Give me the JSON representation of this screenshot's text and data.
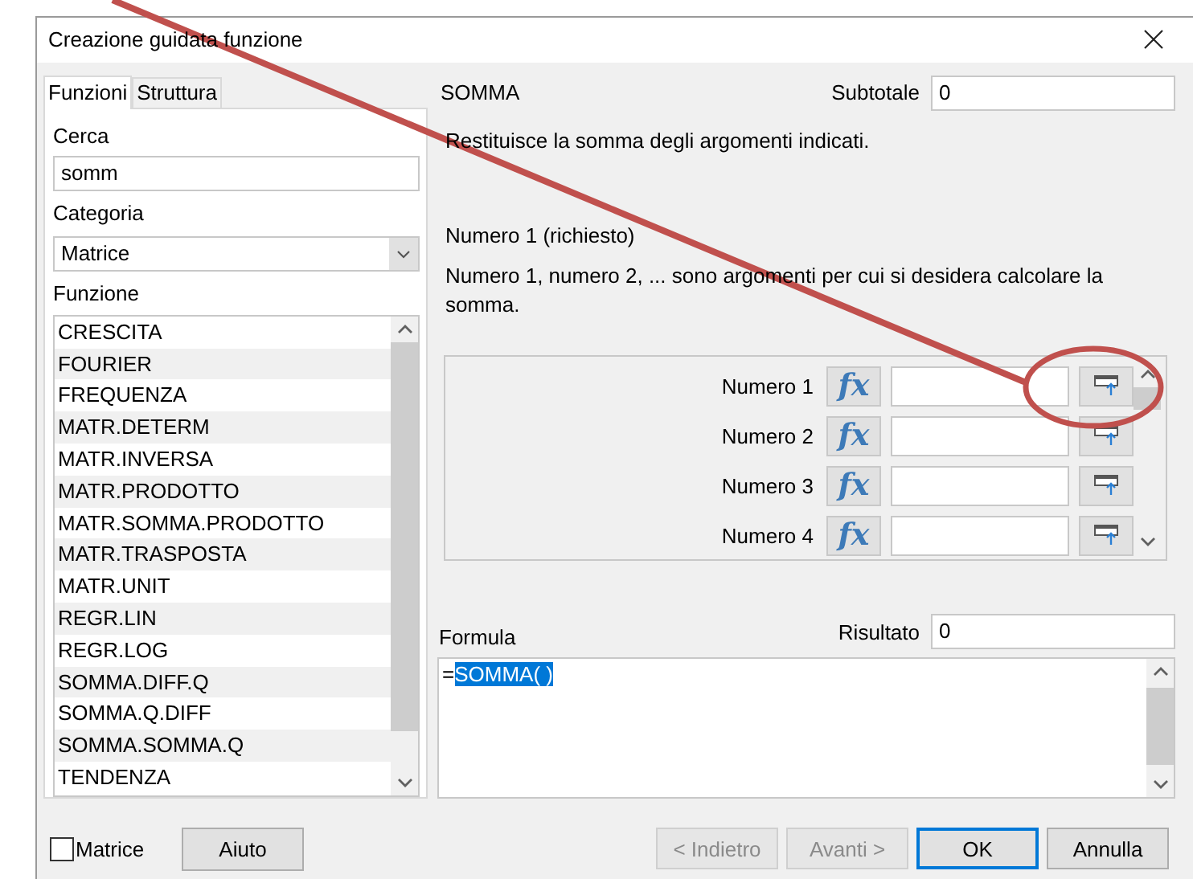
{
  "window": {
    "title": "Creazione guidata funzione"
  },
  "tabs": [
    {
      "label": "Funzioni",
      "selected": true
    },
    {
      "label": "Struttura",
      "selected": false
    }
  ],
  "search": {
    "label": "Cerca",
    "value": "somm"
  },
  "category": {
    "label": "Categoria",
    "value": "Matrice"
  },
  "functions": {
    "label": "Funzione",
    "items": [
      "CRESCITA",
      "FOURIER",
      "FREQUENZA",
      "MATR.DETERM",
      "MATR.INVERSA",
      "MATR.PRODOTTO",
      "MATR.SOMMA.PRODOTTO",
      "MATR.TRASPOSTA",
      "MATR.UNIT",
      "REGR.LIN",
      "REGR.LOG",
      "SOMMA.DIFF.Q",
      "SOMMA.Q.DIFF",
      "SOMMA.SOMMA.Q",
      "TENDENZA"
    ]
  },
  "function_name": "SOMMA",
  "subtotal": {
    "label": "Subtotale",
    "value": "0"
  },
  "description": "Restituisce la somma degli argomenti indicati.",
  "argument_title": "Numero 1 (richiesto)",
  "argument_description": "Numero 1, numero 2, ... sono argomenti per cui si desidera calcolare la somma.",
  "arguments": [
    {
      "label": "Numero 1",
      "function_button": "fx"
    },
    {
      "label": "Numero 2",
      "function_button": "fx"
    },
    {
      "label": "Numero 3",
      "function_button": "fx"
    },
    {
      "label": "Numero 4",
      "function_button": "fx"
    }
  ],
  "formula": {
    "label": "Formula",
    "prefix": "=",
    "selected_text": "SOMMA( )"
  },
  "result": {
    "label": "Risultato",
    "value": "0"
  },
  "array_checkbox": {
    "label": "Matrice",
    "checked": false
  },
  "help_button": "Aiuto",
  "buttons": [
    {
      "label": "< Indietro",
      "disabled": true,
      "default": false
    },
    {
      "label": "Avanti >",
      "disabled": true,
      "default": false
    },
    {
      "label": "OK",
      "disabled": false,
      "default": true
    },
    {
      "label": "Annulla",
      "disabled": false,
      "default": false
    }
  ]
}
